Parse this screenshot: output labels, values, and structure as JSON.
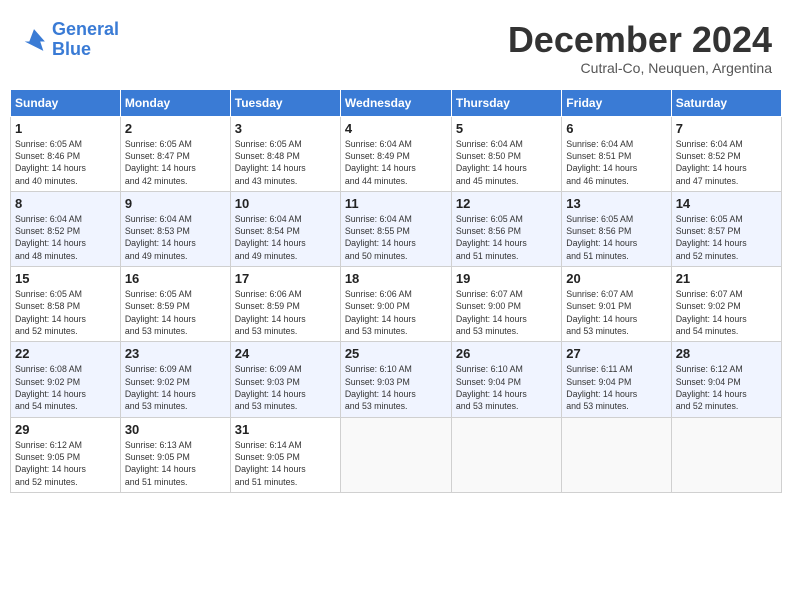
{
  "header": {
    "logo_line1": "General",
    "logo_line2": "Blue",
    "month_title": "December 2024",
    "subtitle": "Cutral-Co, Neuquen, Argentina"
  },
  "weekdays": [
    "Sunday",
    "Monday",
    "Tuesday",
    "Wednesday",
    "Thursday",
    "Friday",
    "Saturday"
  ],
  "rows": [
    [
      {
        "day": "1",
        "info": "Sunrise: 6:05 AM\nSunset: 8:46 PM\nDaylight: 14 hours\nand 40 minutes."
      },
      {
        "day": "2",
        "info": "Sunrise: 6:05 AM\nSunset: 8:47 PM\nDaylight: 14 hours\nand 42 minutes."
      },
      {
        "day": "3",
        "info": "Sunrise: 6:05 AM\nSunset: 8:48 PM\nDaylight: 14 hours\nand 43 minutes."
      },
      {
        "day": "4",
        "info": "Sunrise: 6:04 AM\nSunset: 8:49 PM\nDaylight: 14 hours\nand 44 minutes."
      },
      {
        "day": "5",
        "info": "Sunrise: 6:04 AM\nSunset: 8:50 PM\nDaylight: 14 hours\nand 45 minutes."
      },
      {
        "day": "6",
        "info": "Sunrise: 6:04 AM\nSunset: 8:51 PM\nDaylight: 14 hours\nand 46 minutes."
      },
      {
        "day": "7",
        "info": "Sunrise: 6:04 AM\nSunset: 8:52 PM\nDaylight: 14 hours\nand 47 minutes."
      }
    ],
    [
      {
        "day": "8",
        "info": "Sunrise: 6:04 AM\nSunset: 8:52 PM\nDaylight: 14 hours\nand 48 minutes."
      },
      {
        "day": "9",
        "info": "Sunrise: 6:04 AM\nSunset: 8:53 PM\nDaylight: 14 hours\nand 49 minutes."
      },
      {
        "day": "10",
        "info": "Sunrise: 6:04 AM\nSunset: 8:54 PM\nDaylight: 14 hours\nand 49 minutes."
      },
      {
        "day": "11",
        "info": "Sunrise: 6:04 AM\nSunset: 8:55 PM\nDaylight: 14 hours\nand 50 minutes."
      },
      {
        "day": "12",
        "info": "Sunrise: 6:05 AM\nSunset: 8:56 PM\nDaylight: 14 hours\nand 51 minutes."
      },
      {
        "day": "13",
        "info": "Sunrise: 6:05 AM\nSunset: 8:56 PM\nDaylight: 14 hours\nand 51 minutes."
      },
      {
        "day": "14",
        "info": "Sunrise: 6:05 AM\nSunset: 8:57 PM\nDaylight: 14 hours\nand 52 minutes."
      }
    ],
    [
      {
        "day": "15",
        "info": "Sunrise: 6:05 AM\nSunset: 8:58 PM\nDaylight: 14 hours\nand 52 minutes."
      },
      {
        "day": "16",
        "info": "Sunrise: 6:05 AM\nSunset: 8:59 PM\nDaylight: 14 hours\nand 53 minutes."
      },
      {
        "day": "17",
        "info": "Sunrise: 6:06 AM\nSunset: 8:59 PM\nDaylight: 14 hours\nand 53 minutes."
      },
      {
        "day": "18",
        "info": "Sunrise: 6:06 AM\nSunset: 9:00 PM\nDaylight: 14 hours\nand 53 minutes."
      },
      {
        "day": "19",
        "info": "Sunrise: 6:07 AM\nSunset: 9:00 PM\nDaylight: 14 hours\nand 53 minutes."
      },
      {
        "day": "20",
        "info": "Sunrise: 6:07 AM\nSunset: 9:01 PM\nDaylight: 14 hours\nand 53 minutes."
      },
      {
        "day": "21",
        "info": "Sunrise: 6:07 AM\nSunset: 9:02 PM\nDaylight: 14 hours\nand 54 minutes."
      }
    ],
    [
      {
        "day": "22",
        "info": "Sunrise: 6:08 AM\nSunset: 9:02 PM\nDaylight: 14 hours\nand 54 minutes."
      },
      {
        "day": "23",
        "info": "Sunrise: 6:09 AM\nSunset: 9:02 PM\nDaylight: 14 hours\nand 53 minutes."
      },
      {
        "day": "24",
        "info": "Sunrise: 6:09 AM\nSunset: 9:03 PM\nDaylight: 14 hours\nand 53 minutes."
      },
      {
        "day": "25",
        "info": "Sunrise: 6:10 AM\nSunset: 9:03 PM\nDaylight: 14 hours\nand 53 minutes."
      },
      {
        "day": "26",
        "info": "Sunrise: 6:10 AM\nSunset: 9:04 PM\nDaylight: 14 hours\nand 53 minutes."
      },
      {
        "day": "27",
        "info": "Sunrise: 6:11 AM\nSunset: 9:04 PM\nDaylight: 14 hours\nand 53 minutes."
      },
      {
        "day": "28",
        "info": "Sunrise: 6:12 AM\nSunset: 9:04 PM\nDaylight: 14 hours\nand 52 minutes."
      }
    ],
    [
      {
        "day": "29",
        "info": "Sunrise: 6:12 AM\nSunset: 9:05 PM\nDaylight: 14 hours\nand 52 minutes."
      },
      {
        "day": "30",
        "info": "Sunrise: 6:13 AM\nSunset: 9:05 PM\nDaylight: 14 hours\nand 51 minutes."
      },
      {
        "day": "31",
        "info": "Sunrise: 6:14 AM\nSunset: 9:05 PM\nDaylight: 14 hours\nand 51 minutes."
      },
      {
        "day": "",
        "info": ""
      },
      {
        "day": "",
        "info": ""
      },
      {
        "day": "",
        "info": ""
      },
      {
        "day": "",
        "info": ""
      }
    ]
  ]
}
